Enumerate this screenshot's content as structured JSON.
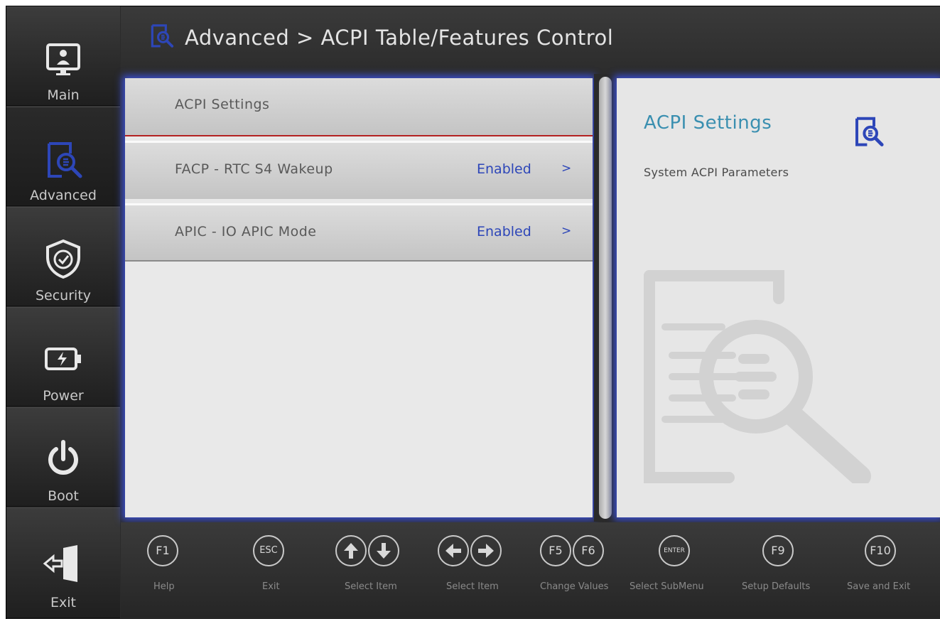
{
  "title": "Advanced > ACPI Table/Features Control",
  "sidebar": {
    "items": [
      {
        "label": "Main",
        "icon": "monitor-user-icon"
      },
      {
        "label": "Advanced",
        "icon": "document-search-icon"
      },
      {
        "label": "Security",
        "icon": "shield-check-icon"
      },
      {
        "label": "Power",
        "icon": "battery-icon"
      },
      {
        "label": "Boot",
        "icon": "power-icon"
      },
      {
        "label": "Exit",
        "icon": "exit-door-icon"
      }
    ],
    "active": "Advanced"
  },
  "settings": [
    {
      "name": "ACPI Settings"
    },
    {
      "name": "FACP - RTC S4 Wakeup",
      "value": "Enabled",
      "arrow": ">"
    },
    {
      "name": "APIC - IO APIC Mode",
      "value": "Enabled",
      "arrow": ">"
    }
  ],
  "help": {
    "title": "ACPI Settings",
    "description": "System ACPI Parameters"
  },
  "footer": {
    "keys": [
      {
        "key": "F1",
        "label": "Help"
      },
      {
        "key": "ESC",
        "label": "Exit"
      },
      {
        "key": "up-arrow",
        "label": "Select Item"
      },
      {
        "key": "down-arrow",
        "label": ""
      },
      {
        "key": "left-arrow",
        "label": "Select Item"
      },
      {
        "key": "right-arrow",
        "label": ""
      },
      {
        "key": "F5",
        "label": "Change Values"
      },
      {
        "key": "F6",
        "label": ""
      },
      {
        "key": "ENTER",
        "label": "Select SubMenu"
      },
      {
        "key": "F9",
        "label": "Setup Defaults"
      },
      {
        "key": "F10",
        "label": "Save and Exit"
      }
    ]
  },
  "colors": {
    "accent_blue": "#2d46b8",
    "help_title": "#3a8fb0",
    "selected_border": "#b42222",
    "glow": "#3b4fd0"
  }
}
